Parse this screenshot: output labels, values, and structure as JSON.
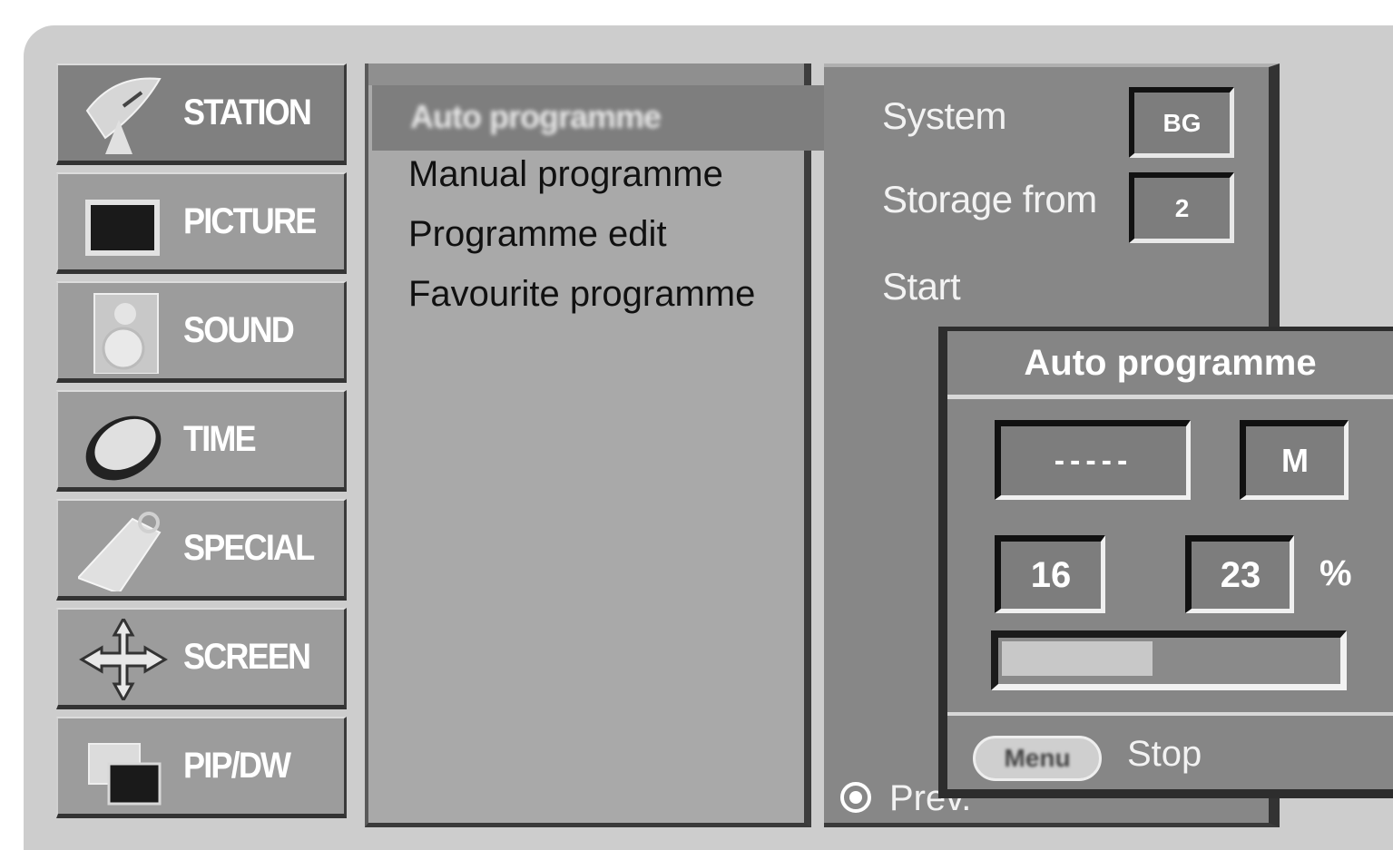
{
  "categories": [
    {
      "label": "STATION",
      "icon": "satellite-dish-icon",
      "active": true
    },
    {
      "label": "PICTURE",
      "icon": "tv-screen-icon",
      "active": false
    },
    {
      "label": "SOUND",
      "icon": "speaker-icon",
      "active": false
    },
    {
      "label": "TIME",
      "icon": "clock-icon",
      "active": false
    },
    {
      "label": "SPECIAL",
      "icon": "tag-icon",
      "active": false
    },
    {
      "label": "SCREEN",
      "icon": "move-arrows-icon",
      "active": false
    },
    {
      "label": "PIP/DW",
      "icon": "pip-windows-icon",
      "active": false
    }
  ],
  "submenu": {
    "selected": "Auto programme",
    "items": [
      "Manual programme",
      "Programme edit",
      "Favourite programme"
    ]
  },
  "options": {
    "system_label": "System",
    "system_value": "BG",
    "storage_label": "Storage from",
    "storage_value": "2",
    "start_label": "Start",
    "prev_label": "Prev."
  },
  "popup": {
    "title": "Auto programme",
    "station_name": "-----",
    "mode": "M",
    "programme_number": "16",
    "percent_value": "23",
    "percent_sign": "%",
    "progress_fraction": 0.45,
    "menu_button": "Menu",
    "stop_label": "Stop"
  }
}
